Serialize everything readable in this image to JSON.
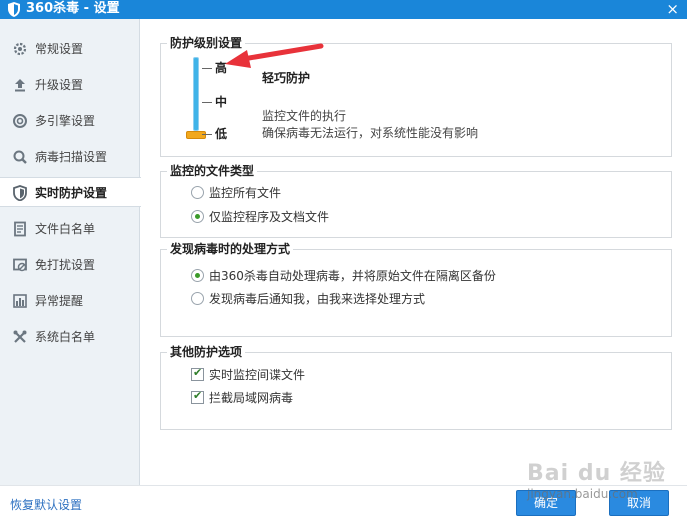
{
  "window": {
    "title": "360杀毒 - 设置",
    "close_glyph": "×"
  },
  "sidebar": {
    "items": [
      {
        "label": "常规设置",
        "icon": "gear-icon"
      },
      {
        "label": "升级设置",
        "icon": "upload-icon"
      },
      {
        "label": "多引擎设置",
        "icon": "engine-icon"
      },
      {
        "label": "病毒扫描设置",
        "icon": "search-icon"
      },
      {
        "label": "实时防护设置",
        "icon": "shield-icon",
        "active": true
      },
      {
        "label": "文件白名单",
        "icon": "document-icon"
      },
      {
        "label": "免打扰设置",
        "icon": "no-disturb-icon"
      },
      {
        "label": "异常提醒",
        "icon": "bar-chart-icon"
      },
      {
        "label": "系统白名单",
        "icon": "tools-icon"
      }
    ]
  },
  "protection_level": {
    "title": "防护级别设置",
    "levels": [
      "高",
      "中",
      "低"
    ],
    "selected_level": "高",
    "level_name": "轻巧防护",
    "desc_line1": "监控文件的执行",
    "desc_line2": "确保病毒无法运行，对系统性能没有影响"
  },
  "monitored_types": {
    "title": "监控的文件类型",
    "options": [
      {
        "label": "监控所有文件",
        "checked": false
      },
      {
        "label": "仅监控程序及文档文件",
        "checked": true
      }
    ]
  },
  "virus_handling": {
    "title": "发现病毒时的处理方式",
    "options": [
      {
        "label": "由360杀毒自动处理病毒，并将原始文件在隔离区备份",
        "checked": true
      },
      {
        "label": "发现病毒后通知我，由我来选择处理方式",
        "checked": false
      }
    ]
  },
  "other_options": {
    "title": "其他防护选项",
    "options": [
      {
        "label": "实时监控间谍文件",
        "checked": true
      },
      {
        "label": "拦截局域网病毒",
        "checked": true
      }
    ]
  },
  "footer": {
    "restore_label": "恢复默认设置",
    "ok_label": "确定",
    "cancel_label": "取消"
  },
  "watermark": {
    "text": "Bai du 经验",
    "url": "jingyan.baidu.com"
  },
  "colors": {
    "titlebar": "#1a86d9",
    "accent_arrow": "#e8323a",
    "slider": "#3fb3e8",
    "knob": "#f2a81d"
  }
}
